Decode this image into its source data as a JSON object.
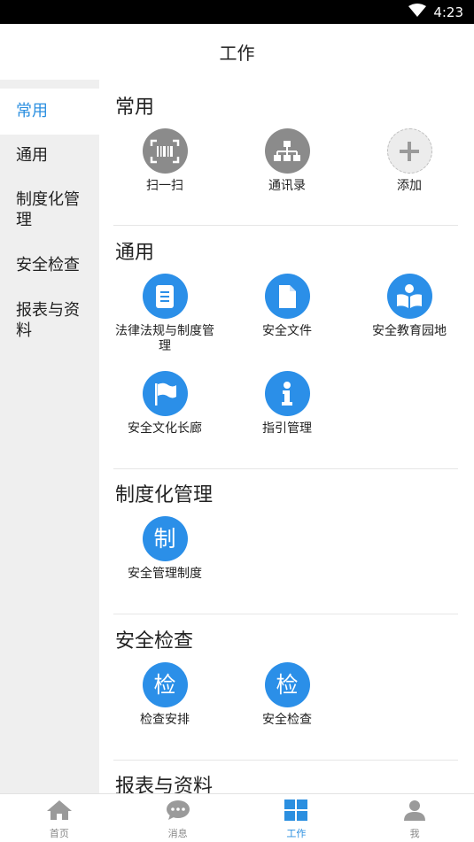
{
  "status_bar": {
    "time": "4:23"
  },
  "header": {
    "title": "工作"
  },
  "sidebar": {
    "items": [
      {
        "label": "常用",
        "active": true
      },
      {
        "label": "通用",
        "active": false
      },
      {
        "label": "制度化管理",
        "active": false
      },
      {
        "label": "安全检查",
        "active": false
      },
      {
        "label": "报表与资料",
        "active": false
      }
    ]
  },
  "sections": {
    "common": {
      "title": "常用",
      "items": [
        {
          "label": "扫一扫",
          "icon": "barcode-scan-icon"
        },
        {
          "label": "通讯录",
          "icon": "org-chart-icon"
        },
        {
          "label": "添加",
          "icon": "plus-icon"
        }
      ]
    },
    "general": {
      "title": "通用",
      "items": [
        {
          "label": "法律法规与制度管理",
          "icon": "book-icon"
        },
        {
          "label": "安全文件",
          "icon": "document-icon"
        },
        {
          "label": "安全教育园地",
          "icon": "reader-icon"
        },
        {
          "label": "安全文化长廊",
          "icon": "flag-icon"
        },
        {
          "label": "指引管理",
          "icon": "info-icon"
        }
      ]
    },
    "institution": {
      "title": "制度化管理",
      "items": [
        {
          "label": "安全管理制度",
          "glyph": "制"
        }
      ]
    },
    "inspection": {
      "title": "安全检查",
      "items": [
        {
          "label": "检查安排",
          "glyph": "检"
        },
        {
          "label": "安全检查",
          "glyph": "检"
        }
      ]
    },
    "reports": {
      "title": "报表与资料"
    }
  },
  "bottom_nav": {
    "items": [
      {
        "label": "首页",
        "icon": "home-icon"
      },
      {
        "label": "消息",
        "icon": "chat-icon"
      },
      {
        "label": "工作",
        "icon": "grid-icon",
        "active": true
      },
      {
        "label": "我",
        "icon": "person-icon"
      }
    ]
  },
  "colors": {
    "accent": "#2b8fe0",
    "icon_blue": "#2b8fe8",
    "icon_grey": "#8b8b8b",
    "sidebar_bg": "#efefef"
  }
}
